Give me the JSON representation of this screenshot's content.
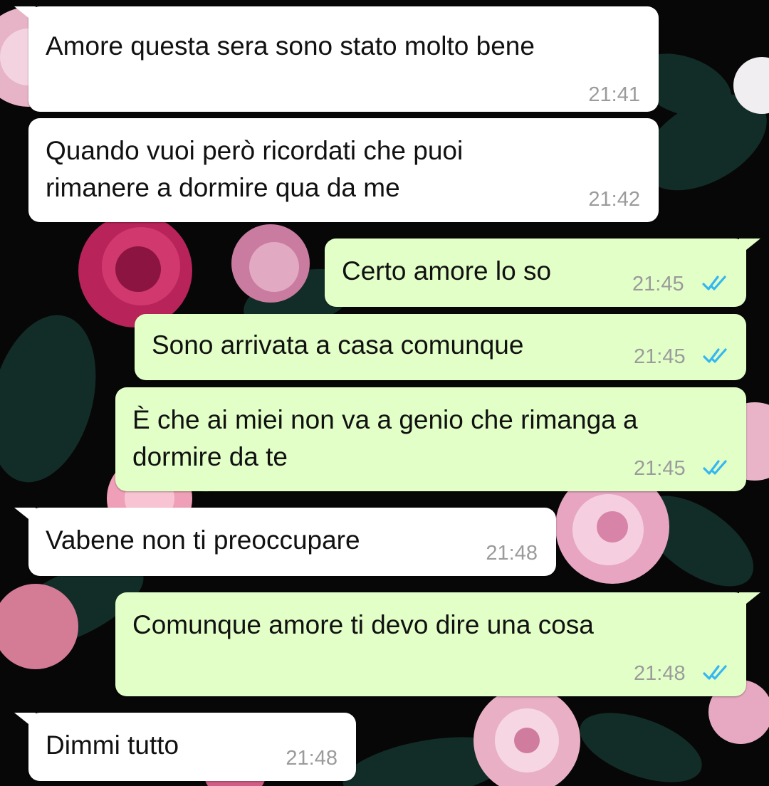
{
  "chat": {
    "messages": [
      {
        "direction": "incoming",
        "text": "Amore questa sera sono stato molto bene",
        "time": "21:41"
      },
      {
        "direction": "incoming",
        "text": "Quando vuoi però ricordati che puoi\nrimanere a dormire qua da me",
        "time": "21:42"
      },
      {
        "direction": "outgoing",
        "text": "Certo amore lo so",
        "time": "21:45",
        "status_icon": "read-double-check-icon"
      },
      {
        "direction": "outgoing",
        "text": "Sono arrivata a casa comunque",
        "time": "21:45",
        "status_icon": "read-double-check-icon"
      },
      {
        "direction": "outgoing",
        "text": "È che ai miei non va a genio che rimanga a\ndormire da te",
        "time": "21:45",
        "status_icon": "read-double-check-icon"
      },
      {
        "direction": "incoming",
        "text": "Vabene non ti preoccupare",
        "time": "21:48"
      },
      {
        "direction": "outgoing",
        "text": "Comunque amore ti devo dire una cosa",
        "time": "21:48",
        "status_icon": "read-double-check-icon"
      },
      {
        "direction": "incoming",
        "text": "Dimmi tutto",
        "time": "21:48"
      }
    ]
  },
  "colors": {
    "incoming_bubble": "#ffffff",
    "outgoing_bubble": "#e2ffc7",
    "read_ticks": "#34b7f1",
    "timestamp": "#9b9b9b",
    "wallpaper_background": "#070707",
    "flower_pink": "#e9a9c0",
    "flower_magenta": "#b8235a",
    "leaf_green": "#14302a"
  },
  "wallpaper": {
    "theme": "dark-floral"
  }
}
